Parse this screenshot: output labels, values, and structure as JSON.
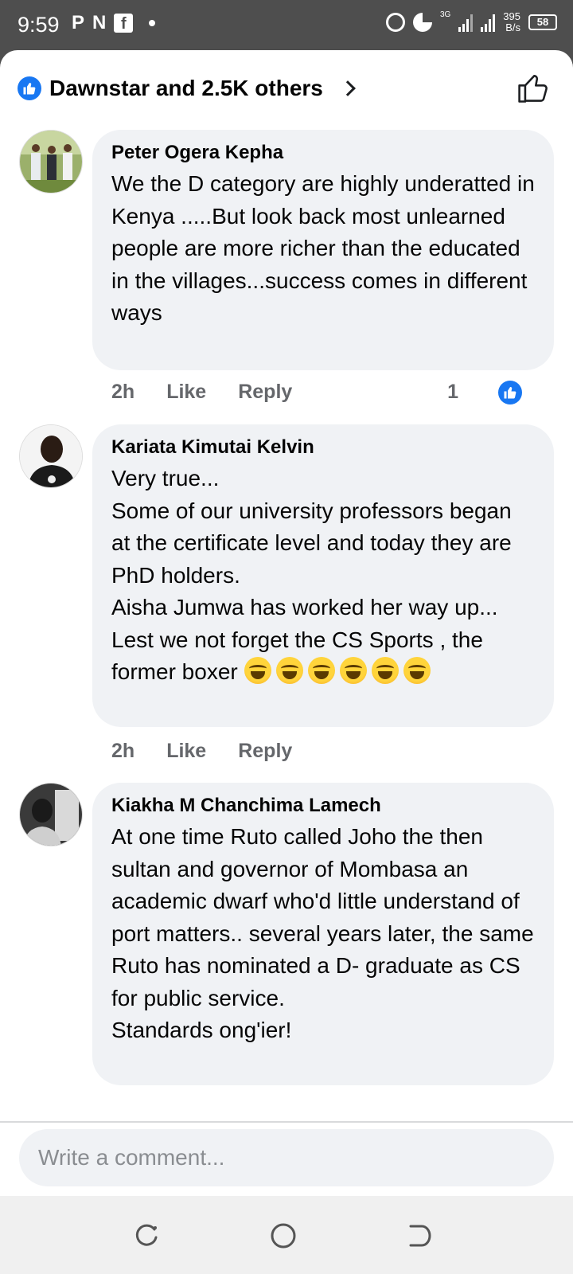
{
  "status_bar": {
    "time": "9:59",
    "left_icons": [
      "P",
      "N",
      "f"
    ],
    "network": "3G",
    "speed_value": "395",
    "speed_unit": "B/s",
    "battery": "58"
  },
  "reactions": {
    "text": "Dawnstar and 2.5K others"
  },
  "comments": [
    {
      "author": "Peter Ogera Kepha",
      "text": "We the D category are highly underatted in Kenya .....But look back most unlearned people are more richer than the educated in the villages...success comes in different ways",
      "time": "2h",
      "like": "Like",
      "reply": "Reply",
      "like_count": "1"
    },
    {
      "author": "Kariata Kimutai Kelvin",
      "lines": [
        "Very true...",
        "Some of our university professors began at the certificate level and today they are PhD holders.",
        "Aisha Jumwa has worked her way up...",
        "Lest we not forget the CS Sports , the former boxer"
      ],
      "emoji_count": 6,
      "emoji_name": "laughing-tears",
      "time": "2h",
      "like": "Like",
      "reply": "Reply"
    },
    {
      "author": "Kiakha M Chanchima Lamech",
      "lines": [
        "At one time Ruto called Joho the then sultan and governor of Mombasa an academic dwarf who'd little understand of port matters.. several years later, the same Ruto has nominated a D- graduate as CS for public service.",
        "Standards ong'ier!"
      ]
    }
  ],
  "composer": {
    "placeholder": "Write a comment..."
  },
  "colors": {
    "facebook_blue": "#1877f2",
    "bubble": "#f0f2f5",
    "status_bar": "#4e4e4e"
  }
}
